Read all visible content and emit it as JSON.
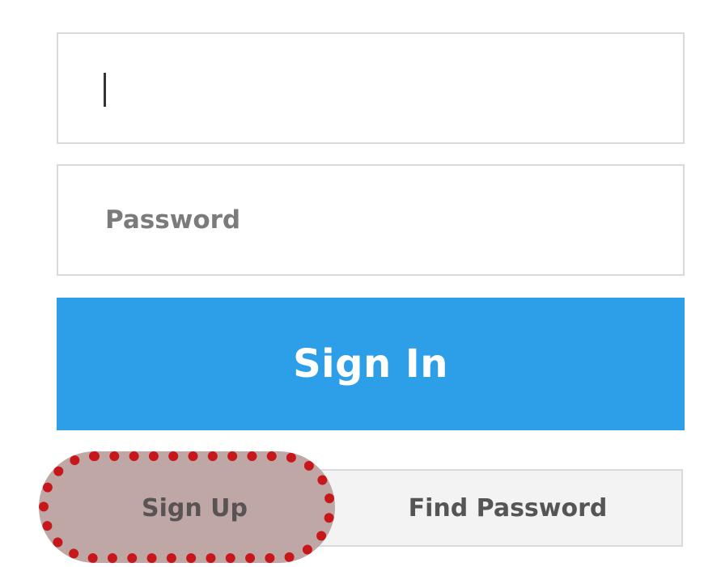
{
  "form": {
    "id_field": {
      "value": "",
      "placeholder": ""
    },
    "password_field": {
      "value": "",
      "placeholder": "Password"
    },
    "signin_label": "Sign In",
    "signup_label": "Sign Up",
    "find_password_label": "Find Password"
  },
  "colors": {
    "primary_button": "#2d9fe8",
    "highlight_border": "#c8171b",
    "highlight_fill": "#bea7a5",
    "field_border": "#d9d9d9",
    "link_row_background": "#f3f3f3"
  }
}
